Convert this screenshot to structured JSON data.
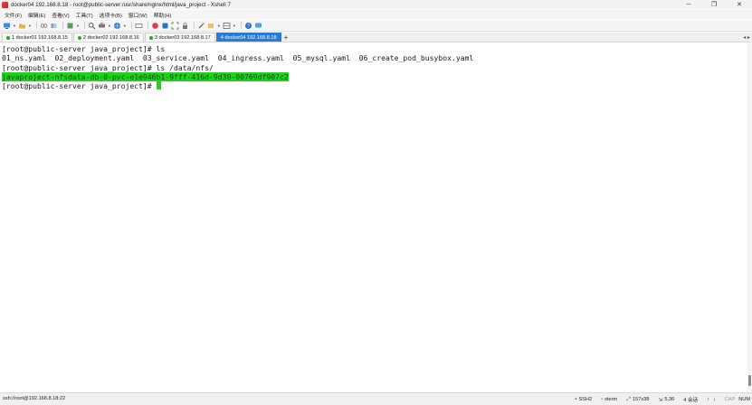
{
  "window": {
    "title": "docker04 192.168.8.18 - root@public-server:/usr/share/nginx/html/java_project - Xshell 7",
    "minimize": "─",
    "maximize": "❐",
    "close": "✕"
  },
  "menu": {
    "items": [
      {
        "label": "文件(F)"
      },
      {
        "label": "编辑(E)"
      },
      {
        "label": "查看(V)"
      },
      {
        "label": "工具(T)"
      },
      {
        "label": "选项卡(B)"
      },
      {
        "label": "窗口(W)"
      },
      {
        "label": "帮助(H)"
      }
    ]
  },
  "tabs": [
    {
      "label": "1 docker01 192.168.8.15",
      "dot_color": "#2aa52a",
      "active": false
    },
    {
      "label": "2 docker02 192.168.8.16",
      "dot_color": "#2aa52a",
      "active": false
    },
    {
      "label": "3 docker03 192.168.8.17",
      "dot_color": "#2aa52a",
      "active": false
    },
    {
      "label": "4 docker04 192.168.8.18",
      "dot_color": "#ffffff",
      "active": true
    }
  ],
  "tab_add": "+",
  "tab_nav": "◂ ▸",
  "terminal": {
    "lines": [
      {
        "text": "[root@public-server java_project]# ls"
      },
      {
        "text": "01_ns.yaml  02_deployment.yaml  03_service.yaml  04_ingress.yaml  05_mysql.yaml  06_create_pod_busybox.yaml"
      },
      {
        "text": "[root@public-server java_project]# ls /data/nfs/"
      },
      {
        "text": "javaproject-nfsdata-db-0-pvc-e1e946b1-9fff-416d-9d30-00769df907c2"
      },
      {
        "text": "[root@public-server java_project]# "
      }
    ],
    "highlight_color": "#1ed21e"
  },
  "status": {
    "host": "ssh://root@192.168.8.18:22",
    "protocol": "SSH2",
    "terminal_type": "xterm",
    "size": "157x38",
    "cursor_pos": "5,36",
    "sessions": "4 会话",
    "caps": "CAP",
    "num": "NUM"
  }
}
